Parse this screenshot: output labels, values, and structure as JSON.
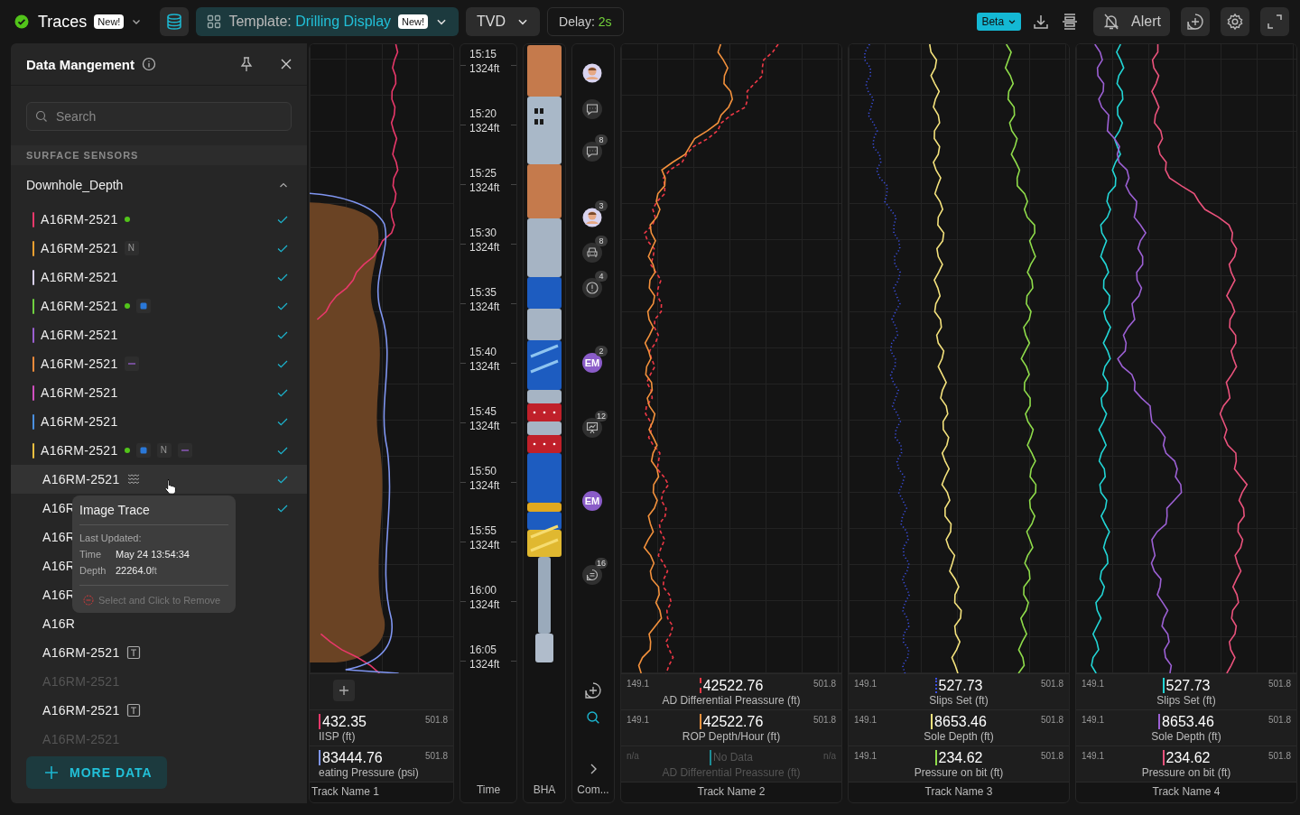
{
  "topbar": {
    "app_title": "Traces",
    "app_badge": "New!",
    "template_label": "Template:",
    "template_name": "Drilling Display",
    "template_badge": "New!",
    "depth_mode": "TVD",
    "delay_label": "Delay:",
    "delay_value": "2s",
    "beta": "Beta",
    "alert": "Alert"
  },
  "panel": {
    "title": "Data Mangement",
    "search_placeholder": "Search",
    "section": "SURFACE SENSORS",
    "group": "Downhole_Depth",
    "expanded": true,
    "items": [
      {
        "name": "A16RM-2521",
        "color": "#e8386a",
        "tags": [
          {
            "kind": "live"
          }
        ],
        "checked": true,
        "disabled": false,
        "hovered": false
      },
      {
        "name": "A16RM-2521",
        "color": "#f0a030",
        "tags": [
          {
            "kind": "letter",
            "text": "N"
          }
        ],
        "checked": true,
        "disabled": false,
        "hovered": false
      },
      {
        "name": "A16RM-2521",
        "color": "#d8d0f0",
        "checked": true,
        "disabled": false,
        "hovered": false
      },
      {
        "name": "A16RM-2521",
        "color": "#6fd040",
        "tags": [
          {
            "kind": "live"
          },
          {
            "kind": "square"
          }
        ],
        "checked": true,
        "disabled": false,
        "hovered": false
      },
      {
        "name": "A16RM-2521",
        "color": "#9a5fd0",
        "checked": true,
        "disabled": false,
        "hovered": false
      },
      {
        "name": "A16RM-2521",
        "color": "#f08a3a",
        "tags": [
          {
            "kind": "dash"
          }
        ],
        "checked": true,
        "disabled": false,
        "hovered": false
      },
      {
        "name": "A16RM-2521",
        "color": "#d050c0",
        "checked": true,
        "disabled": false,
        "hovered": false
      },
      {
        "name": "A16RM-2521",
        "color": "#4a90e0",
        "checked": true,
        "disabled": false,
        "hovered": false
      },
      {
        "name": "A16RM-2521",
        "color": "#f0c040",
        "tags": [
          {
            "kind": "live"
          },
          {
            "kind": "square"
          },
          {
            "kind": "letter",
            "text": "N"
          },
          {
            "kind": "dash"
          }
        ],
        "checked": true,
        "disabled": false,
        "hovered": false
      },
      {
        "name": "A16RM-2521",
        "tags": [
          {
            "kind": "wave"
          }
        ],
        "checked": true,
        "disabled": false,
        "hovered": true
      },
      {
        "name": "A16R",
        "checked": true,
        "disabled": false,
        "hovered": false
      },
      {
        "name": "A16R",
        "checked": false,
        "disabled": false,
        "hovered": false
      },
      {
        "name": "A16R",
        "checked": false,
        "disabled": false,
        "hovered": false
      },
      {
        "name": "A16R",
        "checked": false,
        "disabled": false,
        "hovered": false
      },
      {
        "name": "A16R",
        "checked": false,
        "disabled": false,
        "hovered": false
      },
      {
        "name": "A16RM-2521",
        "tags": [
          {
            "kind": "text"
          }
        ],
        "checked": false,
        "disabled": false,
        "hovered": false
      },
      {
        "name": "A16RM-2521",
        "checked": false,
        "disabled": true,
        "hovered": false
      },
      {
        "name": "A16RM-2521",
        "tags": [
          {
            "kind": "text"
          }
        ],
        "checked": false,
        "disabled": false,
        "hovered": false
      },
      {
        "name": "A16RM-2521",
        "checked": false,
        "disabled": true,
        "hovered": false
      }
    ],
    "more_button": "MORE DATA",
    "tooltip": {
      "title": "Image Trace",
      "subtitle": "Last Updated:",
      "rows": [
        {
          "label": "Time",
          "value": "May 24 13:54:34"
        },
        {
          "label": "Depth",
          "value": "22264.0",
          "unit": "ft"
        }
      ],
      "action": "Select and Click to Remove"
    }
  },
  "time_column": {
    "label": "Time",
    "ticks": [
      {
        "time": "15:15",
        "depth": "1324ft"
      },
      {
        "time": "15:20",
        "depth": "1324ft"
      },
      {
        "time": "15:25",
        "depth": "1324ft"
      },
      {
        "time": "15:30",
        "depth": "1324ft"
      },
      {
        "time": "15:35",
        "depth": "1324ft"
      },
      {
        "time": "15:40",
        "depth": "1324ft"
      },
      {
        "time": "15:45",
        "depth": "1324ft"
      },
      {
        "time": "15:50",
        "depth": "1324ft"
      },
      {
        "time": "15:55",
        "depth": "1324ft"
      },
      {
        "time": "16:00",
        "depth": "1324ft"
      },
      {
        "time": "16:05",
        "depth": "1324ft"
      }
    ]
  },
  "bha_column": {
    "label": "BHA"
  },
  "comments_column": {
    "label": "Com...",
    "items": [
      {
        "kind": "avatar"
      },
      {
        "kind": "chat"
      },
      {
        "kind": "chat",
        "badge": "8"
      },
      {
        "kind": "avatar",
        "badge": "3"
      },
      {
        "kind": "car",
        "badge": "8"
      },
      {
        "kind": "alert",
        "badge": "4"
      },
      {
        "kind": "initials",
        "text": "EM",
        "badge": "2"
      },
      {
        "kind": "chart",
        "badge": "12"
      },
      {
        "kind": "initials",
        "text": "EM"
      },
      {
        "kind": "note",
        "badge": "16"
      }
    ]
  },
  "tracks": [
    {
      "name": "Track Name 1",
      "image": true,
      "rows": [
        {
          "kind": "add"
        },
        {
          "kind": "value",
          "value": "432.35",
          "label": "IISP (ft)",
          "max": "501.8",
          "color": "#e8386a",
          "dashed": false,
          "dotted": false,
          "disabled": false
        },
        {
          "kind": "value",
          "value": "83444.76",
          "label": "eating Pressure (psi)",
          "max": "501.8",
          "color": "#7f95f0",
          "dashed": false,
          "dotted": false,
          "disabled": false
        }
      ]
    },
    {
      "name": "Track Name 2",
      "image": false,
      "rows": [
        {
          "kind": "value",
          "min": "149.1",
          "value": "42522.76",
          "label": "AD Differential Preassure (ft)",
          "max": "501.8",
          "color": "#ee3846",
          "dashed": true,
          "dotted": false,
          "disabled": false
        },
        {
          "kind": "value",
          "min": "149.1",
          "value": "42522.76",
          "label": "ROP Depth/Hour (ft)",
          "max": "501.8",
          "color": "#f3913c",
          "dashed": false,
          "dotted": false,
          "disabled": false
        },
        {
          "kind": "value",
          "min": "n/a",
          "value": "No Data",
          "label": "AD Differential Preassure (ft)",
          "max": "n/a",
          "color": "#1d8c96",
          "dashed": false,
          "dotted": false,
          "disabled": true
        }
      ]
    },
    {
      "name": "Track Name 3",
      "image": false,
      "rows": [
        {
          "kind": "value",
          "min": "149.1",
          "value": "527.73",
          "label": "Slips Set (ft)",
          "max": "501.8",
          "color": "#3b4fe0",
          "dashed": false,
          "dotted": true,
          "disabled": false
        },
        {
          "kind": "value",
          "min": "149.1",
          "value": "8653.46",
          "label": "Sole Depth (ft)",
          "max": "501.8",
          "color": "#f4e27c",
          "dashed": false,
          "dotted": false,
          "disabled": false
        },
        {
          "kind": "value",
          "min": "149.1",
          "value": "234.62",
          "label": "Pressure on bit (ft)",
          "max": "501.8",
          "color": "#8fdc4a",
          "dashed": false,
          "dotted": false,
          "disabled": false
        }
      ]
    },
    {
      "name": "Track Name 4",
      "image": false,
      "rows": [
        {
          "kind": "value",
          "min": "149.1",
          "value": "527.73",
          "label": "Slips Set (ft)",
          "max": "501.8",
          "color": "#22d6d6",
          "dashed": false,
          "dotted": false,
          "disabled": false
        },
        {
          "kind": "value",
          "min": "149.1",
          "value": "8653.46",
          "label": "Sole Depth (ft)",
          "max": "501.8",
          "color": "#9c60d4",
          "dashed": false,
          "dotted": false,
          "disabled": false
        },
        {
          "kind": "value",
          "min": "149.1",
          "value": "234.62",
          "label": "Pressure on bit (ft)",
          "max": "501.8",
          "color": "#ea527c",
          "dashed": false,
          "dotted": false,
          "disabled": false
        }
      ]
    }
  ]
}
